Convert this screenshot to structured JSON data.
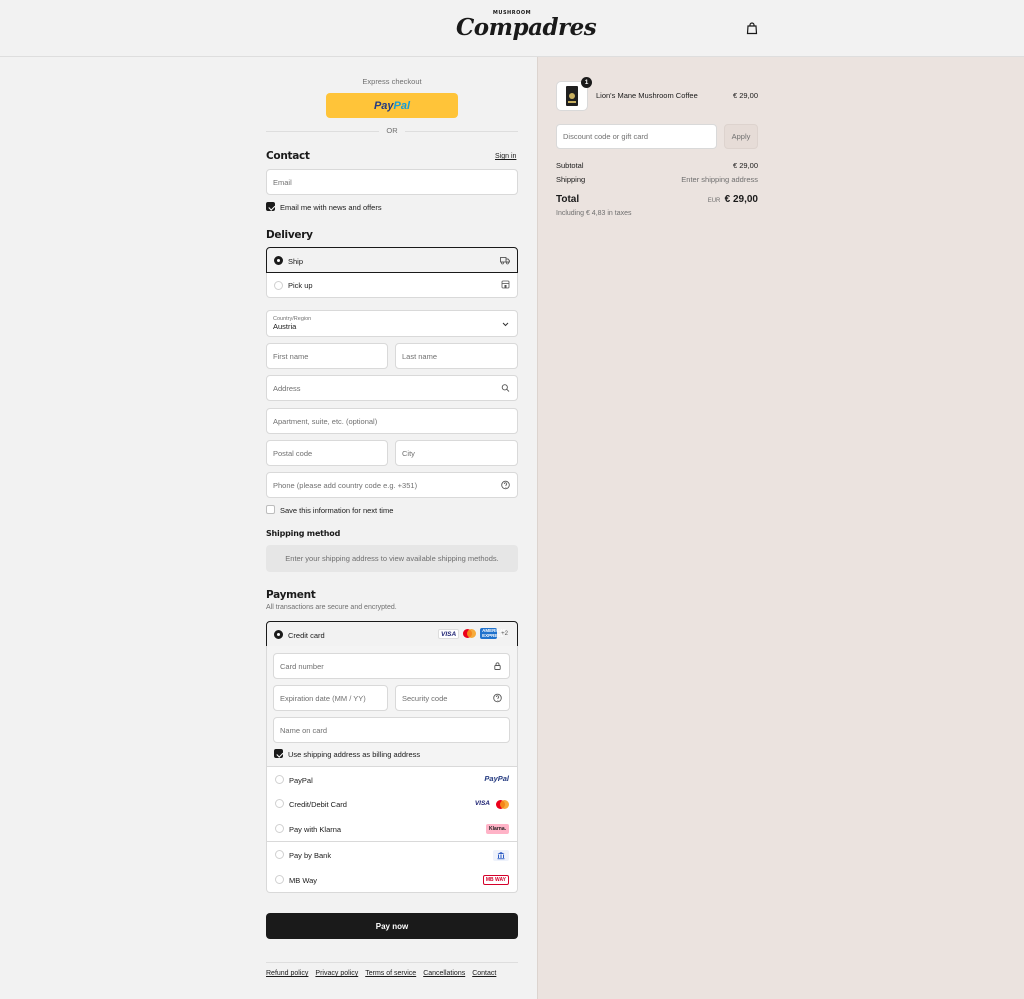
{
  "header": {
    "logo_small": "MUSHROOM",
    "logo_main": "Compadres",
    "cart_icon": "shopping-bag-icon"
  },
  "express": {
    "label": "Express checkout",
    "paypal_dark": "Pay",
    "paypal_light": "Pal",
    "or": "OR"
  },
  "contact": {
    "title": "Contact",
    "sign_in": "Sign in",
    "email_placeholder": "Email",
    "newsletter_label": "Email me with news and offers",
    "newsletter_checked": true
  },
  "delivery": {
    "title": "Delivery",
    "options": [
      {
        "label": "Ship",
        "selected": true,
        "icon": "truck-icon"
      },
      {
        "label": "Pick up",
        "selected": false,
        "icon": "store-icon"
      }
    ],
    "country_label": "Country/Region",
    "country_value": "Austria",
    "first_name": "First name",
    "last_name": "Last name",
    "address": "Address",
    "apartment": "Apartment, suite, etc. (optional)",
    "postal_code": "Postal code",
    "city": "City",
    "phone": "Phone (please add country code e.g. +351)",
    "save_info": "Save this information for next time",
    "save_info_checked": false
  },
  "shipping_method": {
    "title": "Shipping method",
    "note": "Enter your shipping address to view available shipping methods."
  },
  "payment": {
    "title": "Payment",
    "subtitle": "All transactions are secure and encrypted.",
    "credit_card_label": "Credit card",
    "card_brands": [
      "VISA",
      "Mastercard",
      "AMERICAN EXPRESS",
      "+2"
    ],
    "card_number": "Card number",
    "expiration": "Expiration date (MM / YY)",
    "security_code": "Security code",
    "name_on_card": "Name on card",
    "billing_same": "Use shipping address as billing address",
    "billing_same_checked": true,
    "methods": [
      {
        "label": "PayPal",
        "logo": "PayPal"
      },
      {
        "label": "Credit/Debit Card",
        "logo": "VISA"
      },
      {
        "label": "Pay with Klarna",
        "logo": "Klarna."
      },
      {
        "label": "Pay by Bank",
        "logo": "bank-icon"
      },
      {
        "label": "MB Way",
        "logo": "MB WAY"
      }
    ],
    "pay_now": "Pay now"
  },
  "footer": {
    "links": [
      "Refund policy",
      "Privacy policy",
      "Terms of service",
      "Cancellations",
      "Contact"
    ]
  },
  "summary": {
    "item_name": "Lion's Mane Mushroom Coffee",
    "item_price": "€ 29,00",
    "item_qty": "1",
    "discount_placeholder": "Discount code or gift card",
    "apply": "Apply",
    "subtotal_label": "Subtotal",
    "subtotal_value": "€ 29,00",
    "shipping_label": "Shipping",
    "shipping_value": "Enter shipping address",
    "total_label": "Total",
    "currency": "EUR",
    "total_value": "€ 29,00",
    "taxes": "Including € 4,83 in taxes"
  },
  "colors": {
    "accent": "#1a1a1a",
    "paypal_yellow": "#ffc439",
    "summary_bg": "#ebe3df"
  }
}
